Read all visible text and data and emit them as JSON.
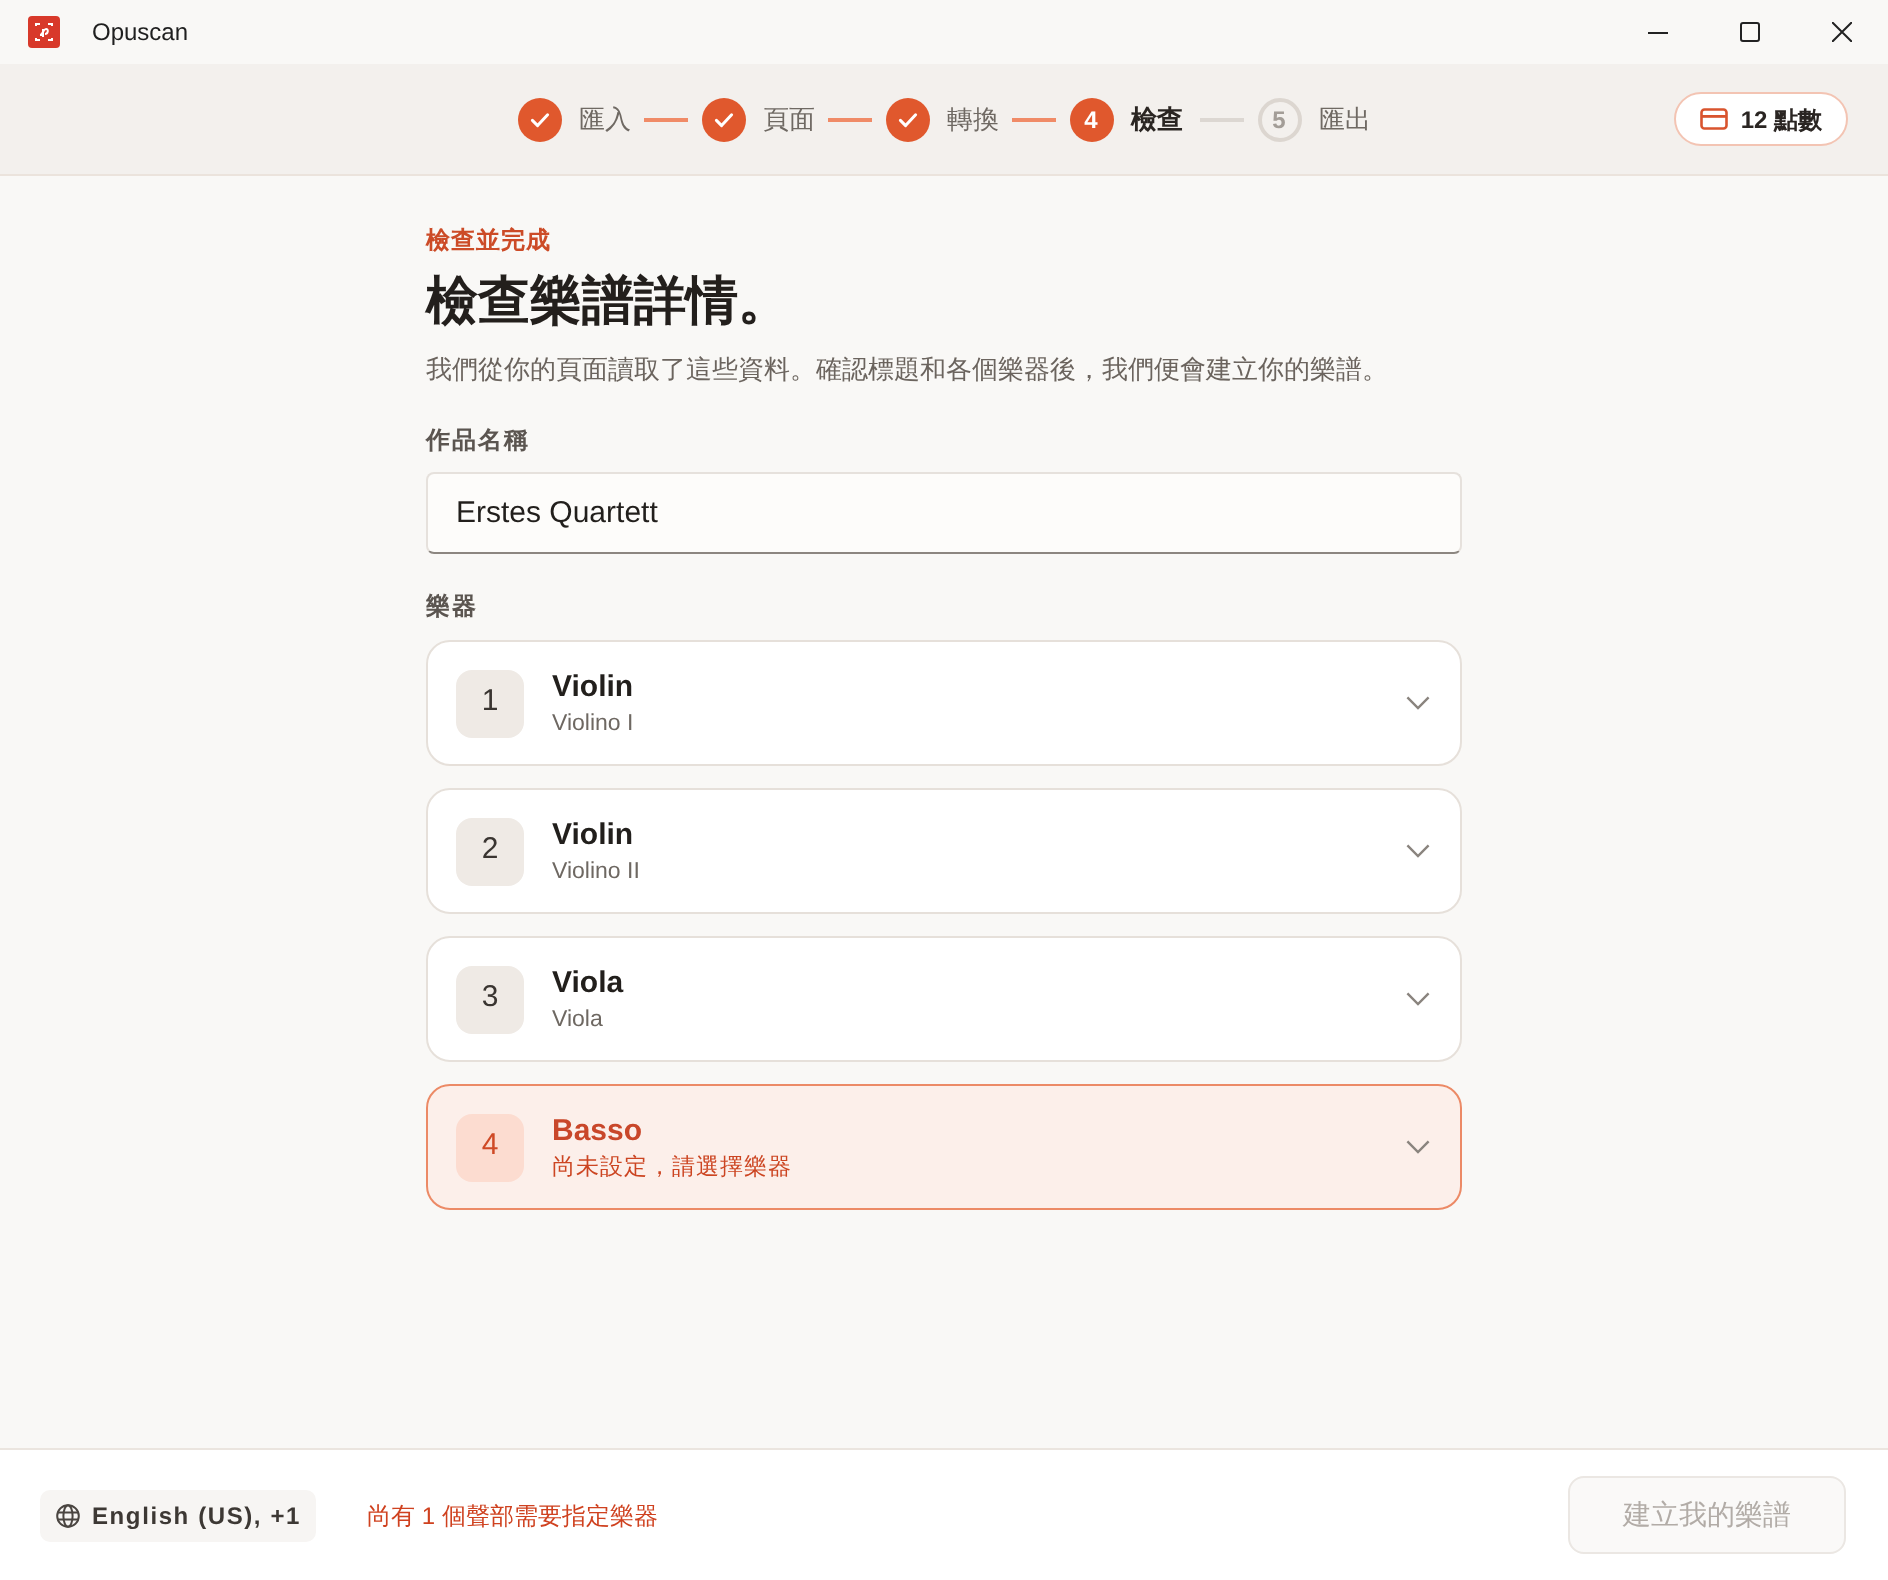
{
  "window": {
    "title": "Opuscan"
  },
  "steps": [
    {
      "label": "匯入",
      "completed": true,
      "selected": false
    },
    {
      "label": "頁面",
      "completed": true,
      "selected": false
    },
    {
      "label": "轉換",
      "completed": true,
      "selected": false
    },
    {
      "number": "4",
      "label": "檢查",
      "completed": false,
      "selected": true
    },
    {
      "number": "5",
      "label": "匯出",
      "completed": false,
      "selected": false
    }
  ],
  "credits": "12 點數",
  "form": {
    "eyebrow": "檢查並完成",
    "heading": "檢查樂譜詳情。",
    "description": "我們從你的頁面讀取了這些資料。確認標題和各個樂器後，我們便會建立你的樂譜。",
    "title_label": "作品名稱",
    "title_value": "Erstes Quartett",
    "instruments_label": "樂器"
  },
  "instruments": [
    {
      "number": "1",
      "name": "Violin",
      "detail": "Violino I",
      "missing": false
    },
    {
      "number": "2",
      "name": "Violin",
      "detail": "Violino II",
      "missing": false
    },
    {
      "number": "3",
      "name": "Viola",
      "detail": "Viola",
      "missing": false
    },
    {
      "number": "4",
      "name": "Basso",
      "detail": "尚未設定，請選擇樂器",
      "missing": true
    }
  ],
  "footer": {
    "language": "English (US), +1",
    "warning": "尚有 1 個聲部需要指定樂器",
    "create_button": {
      "label": "建立我的樂譜",
      "disabled": true
    }
  }
}
